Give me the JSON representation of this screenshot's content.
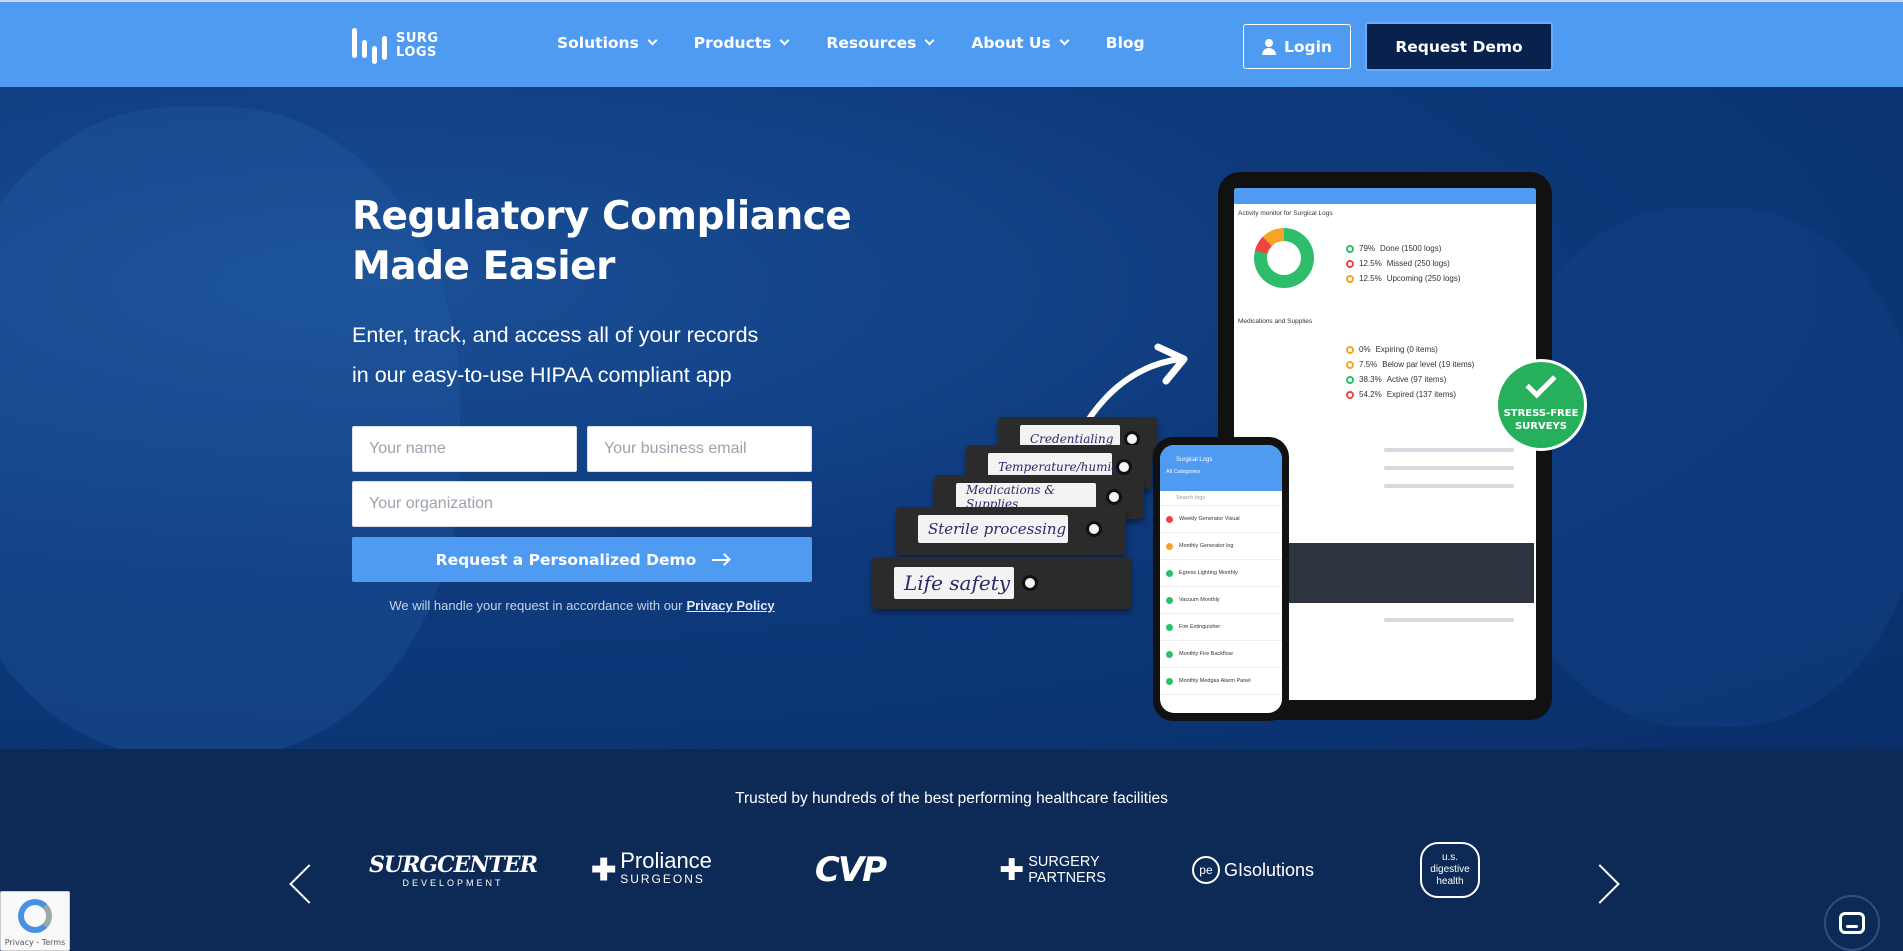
{
  "header": {
    "logo_line1": "SURG",
    "logo_line2": "LOGS",
    "nav": [
      "Solutions",
      "Products",
      "Resources",
      "About Us",
      "Blog"
    ],
    "login_label": "Login",
    "demo_label": "Request Demo"
  },
  "hero": {
    "title_line1": "Regulatory Compliance",
    "title_line2": "Made Easier",
    "subtitle_line1": "Enter, track, and access all of your records",
    "subtitle_line2": "in our easy-to-use HIPAA compliant app",
    "form": {
      "name_placeholder": "Your name",
      "email_placeholder": "Your business email",
      "org_placeholder": "Your organization",
      "submit_label": "Request a Personalized Demo"
    },
    "privacy_text": "We will handle your request in accordance with our",
    "privacy_link": "Privacy Policy"
  },
  "illustration": {
    "badge_line1": "STRESS-FREE",
    "badge_line2": "SURVEYS",
    "binders": [
      "Credentialing",
      "Temperature/humidity",
      "Medications & Supplies",
      "Sterile processing",
      "Life safety"
    ],
    "tablet_header": "Activity monitor for Surgical Logs",
    "tablet_legend": [
      {
        "pct": "79%",
        "label": "Done (1500 logs)",
        "color": "#2ebd6b"
      },
      {
        "pct": "12.5%",
        "label": "Missed (250 logs)",
        "color": "#ef4444"
      },
      {
        "pct": "12.5%",
        "label": "Upcoming (250 logs)",
        "color": "#f5a524"
      }
    ],
    "tablet_section": "Medications and Supplies",
    "tablet_legend2": [
      {
        "pct": "0%",
        "label": "Expiring (0 items)",
        "color": "#f5a524"
      },
      {
        "pct": "7.5%",
        "label": "Below par level (19 items)",
        "color": "#f5a524"
      },
      {
        "pct": "38.3%",
        "label": "Active (97 items)",
        "color": "#2ebd6b"
      },
      {
        "pct": "54.2%",
        "label": "Expired (137 items)",
        "color": "#ef4444"
      }
    ],
    "phone_title": "Surgical Logs",
    "phone_category": "All Categories",
    "phone_search": "Search logs",
    "phone_items": [
      "Weekly Generator Visual",
      "Monthly Generator log",
      "Egress Lighting Monthly",
      "Vacuum Monthly",
      "Fire Extinguisher",
      "Monthly Fire Backflow",
      "Monthly Medgas Alarm Panel"
    ]
  },
  "trusted": {
    "title": "Trusted by hundreds of the best performing healthcare facilities",
    "logos": [
      "SURGCENTER",
      "DEVELOPMENT",
      "Proliance",
      "SURGEONS",
      "CVP",
      "SURGERY",
      "PARTNERS",
      "GIsolutions",
      "u.s. digestive health"
    ]
  },
  "recaptcha": "Privacy - Terms"
}
